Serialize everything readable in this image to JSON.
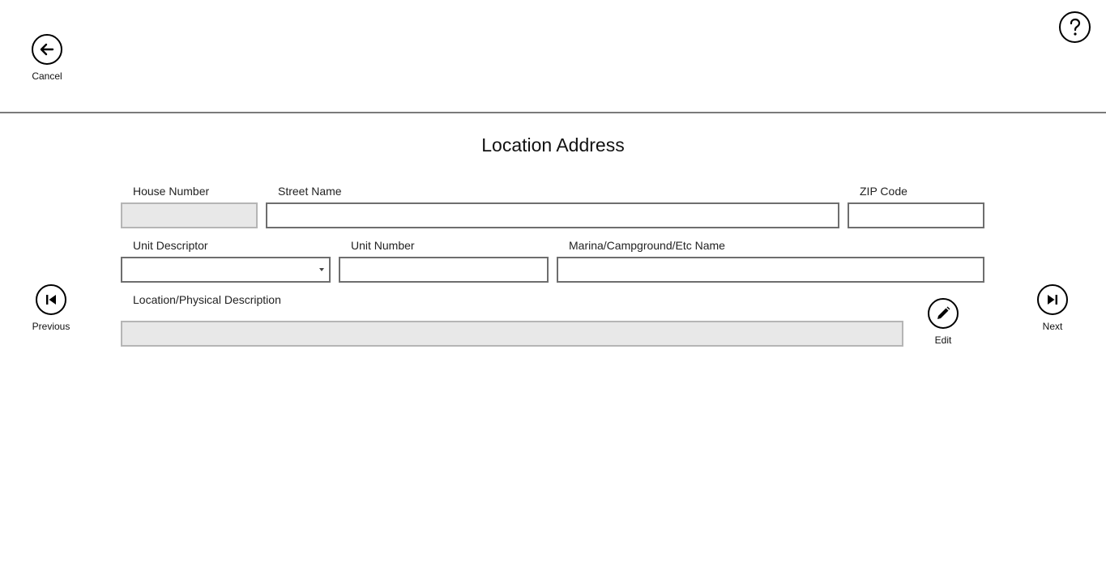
{
  "header": {
    "cancel_label": "Cancel",
    "cancel_icon": "arrow-left-icon",
    "help_icon": "question-mark-icon"
  },
  "title": "Location Address",
  "fields": {
    "house_number": {
      "label": "House Number",
      "value": ""
    },
    "street_name": {
      "label": "Street Name",
      "value": ""
    },
    "zip_code": {
      "label": "ZIP Code",
      "value": ""
    },
    "unit_descriptor": {
      "label": "Unit Descriptor",
      "value": ""
    },
    "unit_number": {
      "label": "Unit Number",
      "value": ""
    },
    "marina_name": {
      "label": "Marina/Campground/Etc Name",
      "value": ""
    },
    "physical_description": {
      "label": "Location/Physical Description",
      "value": ""
    }
  },
  "nav": {
    "previous_label": "Previous",
    "next_label": "Next",
    "edit_label": "Edit",
    "previous_icon": "skip-previous-icon",
    "next_icon": "skip-next-icon",
    "edit_icon": "pencil-icon"
  }
}
